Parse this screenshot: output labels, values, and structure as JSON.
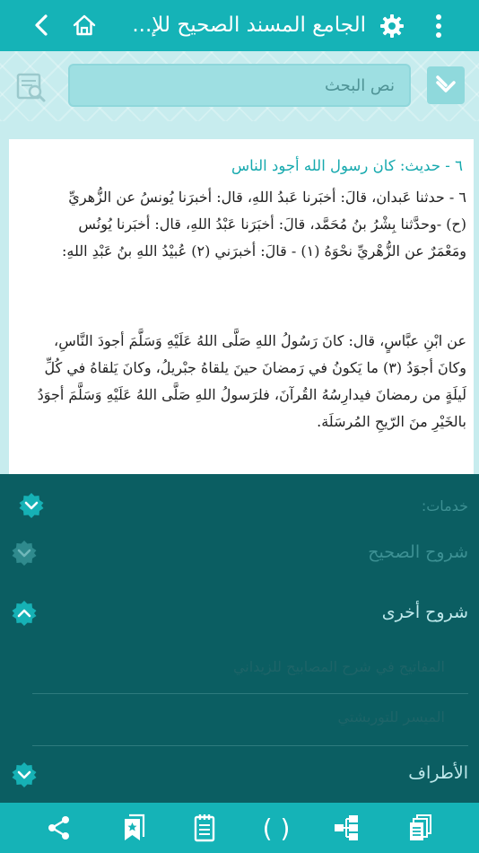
{
  "appbar": {
    "title": "الجامع المسند الصحيح للإ...",
    "icons": [
      "back-chevron-icon",
      "home-icon",
      "gear-icon",
      "kebab-menu-icon"
    ]
  },
  "search": {
    "placeholder": "نص البحث"
  },
  "hadith": {
    "title": "٦ - حديث: كان رسول الله أجود الناس",
    "isnad_lines": [
      "٦ - حدثنا عَبدان، قالَ: أخبَرنا عَبدُ اللهِ، قال: أخبرَنا يُونسُ عن الزُّهريِّ",
      "(ح) -وحدَّثنا بِشْرُ بنُ مُحَمَّد، قالَ: أخبَرَنا عَبْدُ اللهِ، قال: أخبَرنا يُونُس",
      "ومَعْمَرٌ عن الزُّهْريِّ نحْوَهُ (١) - قالَ: أخبرَني (٢) عُبيْدُ اللهِ بنُ عَبْدِ اللهِ:"
    ],
    "matn_lines": [
      "عن ابْنِ عبَّاسٍ، قال: كانَ رَسُولُ اللهِ صَلَّى اللهُ عَلَيْهِ وَسَلَّمَ أجودَ النَّاسِ،",
      "وكانَ أجوَدُ (٣) ما يَكونُ في رَمضانَ حينَ يلقاهُ جبْريلُ، وكانَ يَلقاهُ في كُلِّ",
      "لَيلَةٍ من رمضانَ فيدارِسُهُ القُرآنَ، فلرَسولُ اللهِ صَلَّى اللهُ عَلَيْهِ وَسَلَّمَ أجوَدُ",
      "بالخَيْرِ منَ الرّيحِ المُرسَلَة."
    ]
  },
  "services": {
    "label": "خدمات:",
    "sections": [
      {
        "title": "شروح الصحيح",
        "state": "collapsed"
      },
      {
        "title": "شروح أخرى",
        "state": "expanded",
        "items": [
          "المفاتيح في شرح المصابيح للزيداني",
          "الميسر للتوربشتي"
        ]
      },
      {
        "title": "الأطراف",
        "state": "collapsed"
      }
    ]
  },
  "bottombar": {
    "icons": [
      "share-icon",
      "bookmark-star-icon",
      "notes-icon",
      "parentheses-icon",
      "tree-icon",
      "copy-pages-icon"
    ],
    "parentheses_glyph": "( )"
  },
  "colors": {
    "accent": "#15b3b7",
    "panel": "#0b5e62",
    "hadith_title": "#16a9ae",
    "section_active": "#bfe9ec"
  }
}
